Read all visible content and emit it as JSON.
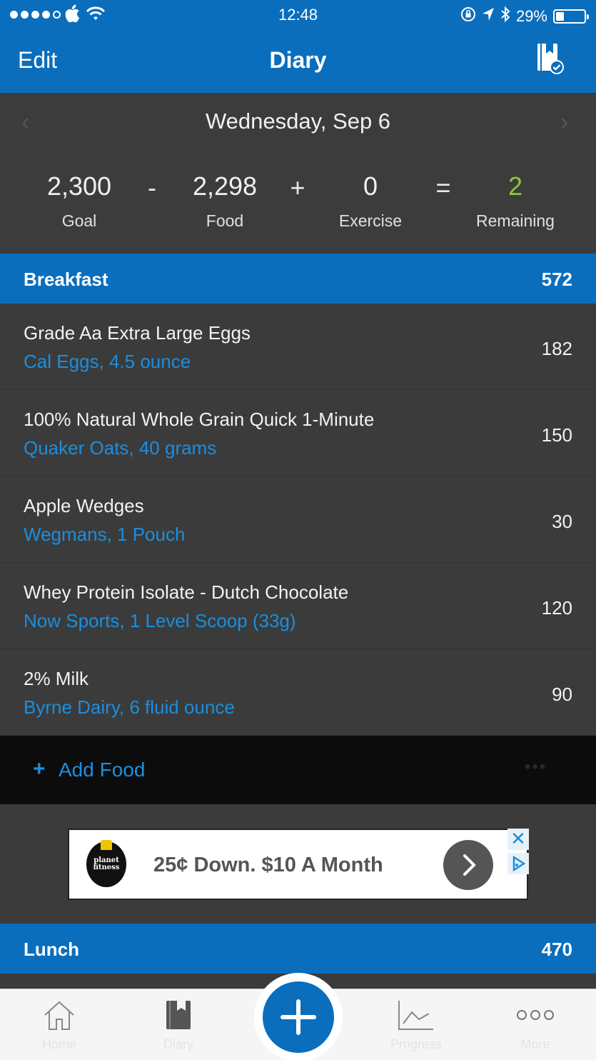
{
  "status_bar": {
    "time": "12:48",
    "battery": "29%",
    "battery_level": 0.29,
    "signal_bars_filled": 4,
    "signal_bars_total": 5
  },
  "nav": {
    "edit_label": "Edit",
    "title": "Diary",
    "checkin_icon": "diary-checkmark-icon"
  },
  "date_bar": {
    "date": "Wednesday, Sep 6",
    "prev_icon": "chevron-left-icon",
    "next_icon": "chevron-right-icon"
  },
  "summary": {
    "goal_value": "2,300",
    "goal_label": "Goal",
    "op_minus": "-",
    "food_value": "2,298",
    "food_label": "Food",
    "op_plus": "+",
    "exercise_value": "0",
    "exercise_label": "Exercise",
    "op_equals": "=",
    "remaining_value": "2",
    "remaining_label": "Remaining",
    "remaining_color": "#8cc63f"
  },
  "breakfast": {
    "name": "Breakfast",
    "calories": "572",
    "items": [
      {
        "name": "Grade Aa Extra Large Eggs",
        "desc": "Cal Eggs, 4.5 ounce",
        "calories": "182"
      },
      {
        "name": "100% Natural Whole Grain Quick 1-Minute",
        "desc": "Quaker Oats, 40 grams",
        "calories": "150"
      },
      {
        "name": "Apple Wedges",
        "desc": "Wegmans, 1 Pouch",
        "calories": "30"
      },
      {
        "name": "Whey Protein Isolate - Dutch Chocolate",
        "desc": "Now Sports, 1 Level Scoop (33g)",
        "calories": "120"
      },
      {
        "name": "2% Milk",
        "desc": "Byrne Dairy, 6 fluid ounce",
        "calories": "90"
      }
    ],
    "add_food_plus": "+",
    "add_food_label": "Add Food",
    "more_label": "•••"
  },
  "ad": {
    "logo_text": "planet fitness",
    "text": "25¢ Down. $10 A Month",
    "close_label": "✕"
  },
  "lunch": {
    "name": "Lunch",
    "calories": "470"
  },
  "tabbar": {
    "tabs": [
      {
        "label": "Home",
        "icon": "home-icon"
      },
      {
        "label": "Diary",
        "icon": "diary-icon"
      },
      {
        "label": "Progress",
        "icon": "progress-chart-icon"
      },
      {
        "label": "More",
        "icon": "more-dots-icon"
      }
    ],
    "fab_icon": "plus-icon"
  },
  "colors": {
    "brand_blue": "#0a6ebd",
    "link_blue": "#1a8fe0",
    "remaining_green": "#8cc63f"
  }
}
